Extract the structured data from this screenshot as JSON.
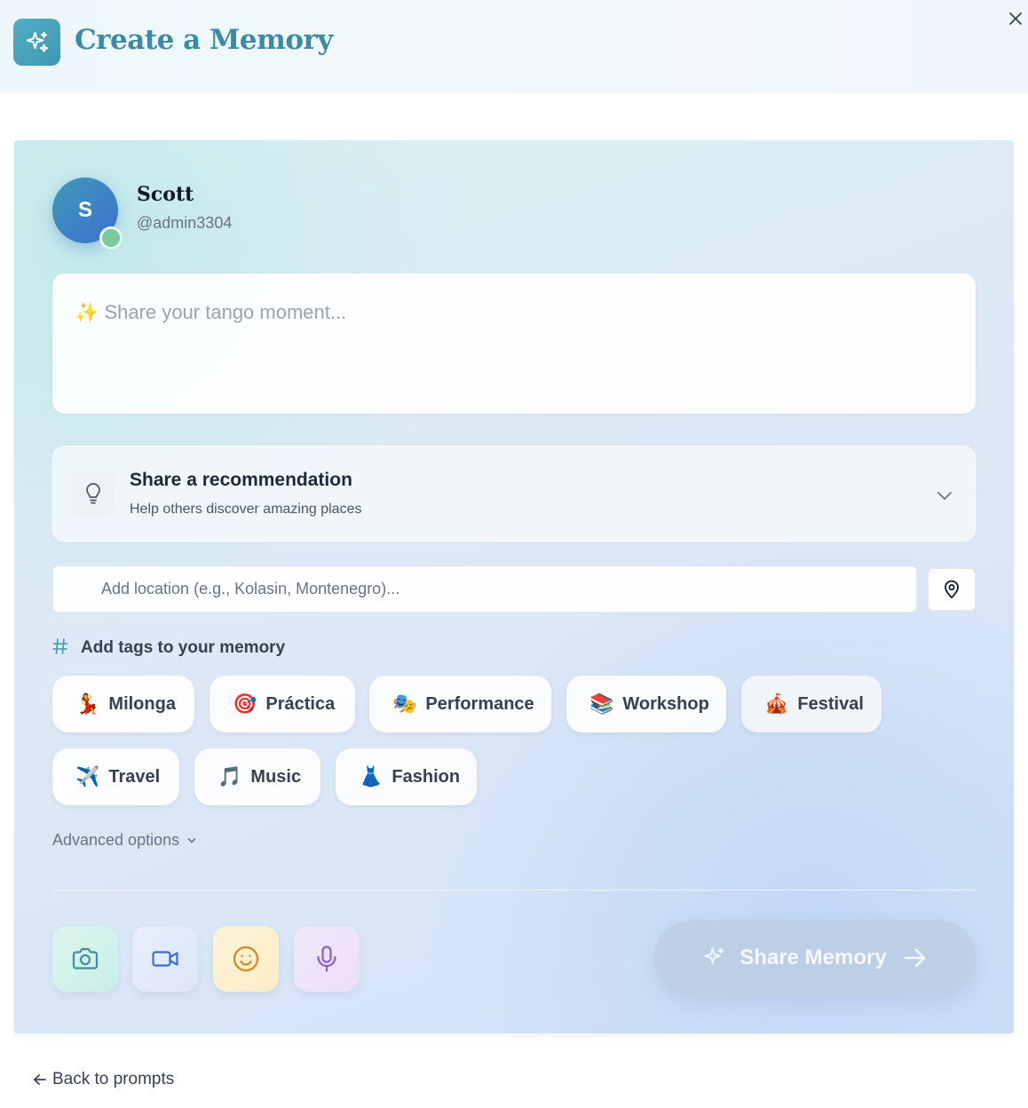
{
  "header": {
    "title": "Create a Memory",
    "logo_icon": "sparkles-icon",
    "close_icon": "close-icon",
    "accent": "#3b8ca3"
  },
  "user": {
    "initial": "S",
    "name": "Scott",
    "handle": "@admin3304",
    "status_color": "#7cc9a0"
  },
  "composer": {
    "placeholder": "✨ Share your tango moment...",
    "value": ""
  },
  "recommendation": {
    "title": "Share a recommendation",
    "subtitle": "Help others discover amazing places",
    "icon": "lightbulb-icon",
    "expand_icon": "chevron-down-icon"
  },
  "location": {
    "placeholder": "Add location (e.g., Kolasin, Montenegro)...",
    "value": "",
    "button_icon": "map-pin-icon"
  },
  "tags": {
    "label": "Add tags to your memory",
    "items": [
      {
        "emoji": "💃",
        "label": "Milonga"
      },
      {
        "emoji": "🎯",
        "label": "Práctica"
      },
      {
        "emoji": "🎭",
        "label": "Performance"
      },
      {
        "emoji": "📚",
        "label": "Workshop"
      },
      {
        "emoji": "🎪",
        "label": "Festival"
      },
      {
        "emoji": "✈️",
        "label": "Travel"
      },
      {
        "emoji": "🎵",
        "label": "Music"
      },
      {
        "emoji": "👗",
        "label": "Fashion"
      }
    ]
  },
  "advanced_options": "Advanced options",
  "media_buttons": [
    {
      "icon": "camera-icon",
      "color": "#3f8fa0"
    },
    {
      "icon": "video-icon",
      "color": "#3b6fd6"
    },
    {
      "icon": "smile-icon",
      "color": "#d28a1e"
    },
    {
      "icon": "microphone-icon",
      "color": "#8b5cd6"
    }
  ],
  "submit": {
    "label": "Share Memory",
    "icon": "sparkles-icon",
    "arrow_icon": "arrow-right-icon"
  },
  "back_link": "Back to prompts"
}
